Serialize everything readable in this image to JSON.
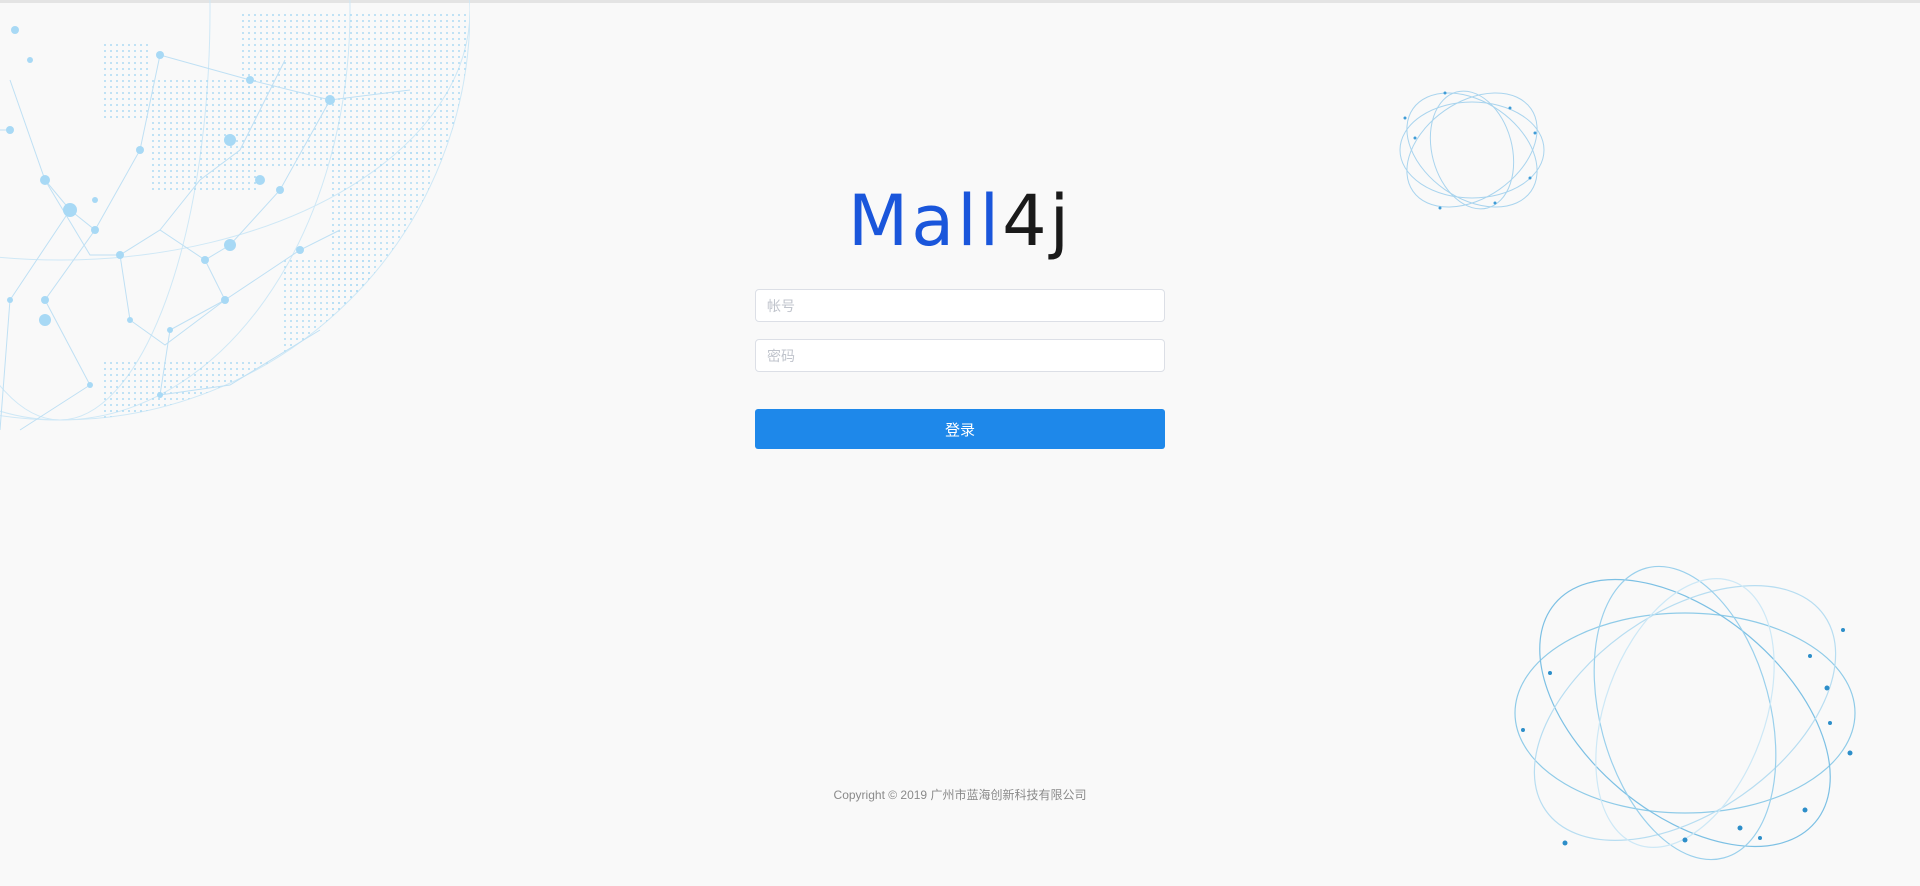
{
  "brand": {
    "logo_part1": "Mall",
    "logo_part2": "4j",
    "logo_colors": {
      "primary": "#1a56db",
      "secondary": "#1a1a1a"
    }
  },
  "login": {
    "username_placeholder": "帐号",
    "username_value": "",
    "password_placeholder": "密码",
    "password_value": "",
    "submit_label": "登录",
    "accent_color": "#1e88ea"
  },
  "footer": {
    "copyright": "Copyright © 2019 广州市蓝海创新科技有限公司"
  },
  "decorations": {
    "globe_icon": "globe-network-icon",
    "orbit_icon": "orbit-rings-icon"
  }
}
